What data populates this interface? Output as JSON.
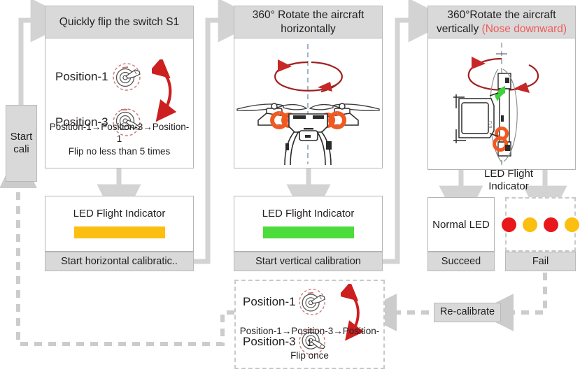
{
  "flow": {
    "start": {
      "line1": "Start",
      "line2": "cali"
    },
    "recalibrate": {
      "label": "Re-calibrate"
    }
  },
  "step1": {
    "header": "Quickly flip the switch S1",
    "position_top": "Position-1",
    "position_bottom": "Position-3",
    "note_line1": "Position-1→Position-3→Position-1",
    "note_line2": "Flip no less than 5 times",
    "icon_top": "switch-hand-up-icon",
    "icon_bottom": "switch-hand-down-icon",
    "arrow_icon": "red-double-arrow-icon"
  },
  "step1_led": {
    "label": "LED Flight Indicator",
    "bar_color": "#FCBE10",
    "footer": "Start horizontal calibratic.."
  },
  "step2": {
    "header_line1": "360° Rotate the aircraft",
    "header_line2": "horizontally",
    "illustration": "drone-front-view-icon",
    "rotation_icon": "horizontal-rotation-arrow-icon",
    "axis_icon": "vertical-dashed-axis-icon"
  },
  "step2_led": {
    "label": "LED Flight Indicator",
    "bar_color": "#4CDC3C",
    "footer": "Start vertical calibration"
  },
  "step3": {
    "header_line1": "360°Rotate the aircraft",
    "header_line2_main": "vertically ",
    "header_line2_red": "(Nose downward)",
    "illustration": "drone-side-view-nose-down-icon",
    "rotation_icon": "vertical-rotation-arrow-icon",
    "axis_icon": "vertical-dashed-axis-icon"
  },
  "step3_led": {
    "label_line1": "LED Flight",
    "label_line2": "Indicator"
  },
  "result_succeed": {
    "body": "Normal LED",
    "footer": "Succeed"
  },
  "result_fail": {
    "footer": "Fаil",
    "dots": [
      "#E8171B",
      "#FCBE10",
      "#E8171B",
      "#FCBE10"
    ]
  },
  "retry": {
    "position_top": "Position-1",
    "position_bottom": "Position-3",
    "note_line1": "Position-1→Position-3→Position-1",
    "note_line2": "Flip once",
    "icon_top": "switch-hand-up-icon",
    "icon_bottom": "switch-hand-down-icon",
    "arrow_icon": "red-double-arrow-icon"
  },
  "colors": {
    "box_fill": "#d9d9d9",
    "box_border": "#b9b9b9",
    "panel_border": "#b4b4b4",
    "wire": "#d3d3d3",
    "dashed_wire": "#cccccc",
    "red_accent": "#CC1F1F",
    "orange_accent": "#F05A22",
    "amber": "#FCBE10",
    "green": "#4CDC3C",
    "red_led": "#E8171B",
    "red_text": "#f05a5a"
  }
}
